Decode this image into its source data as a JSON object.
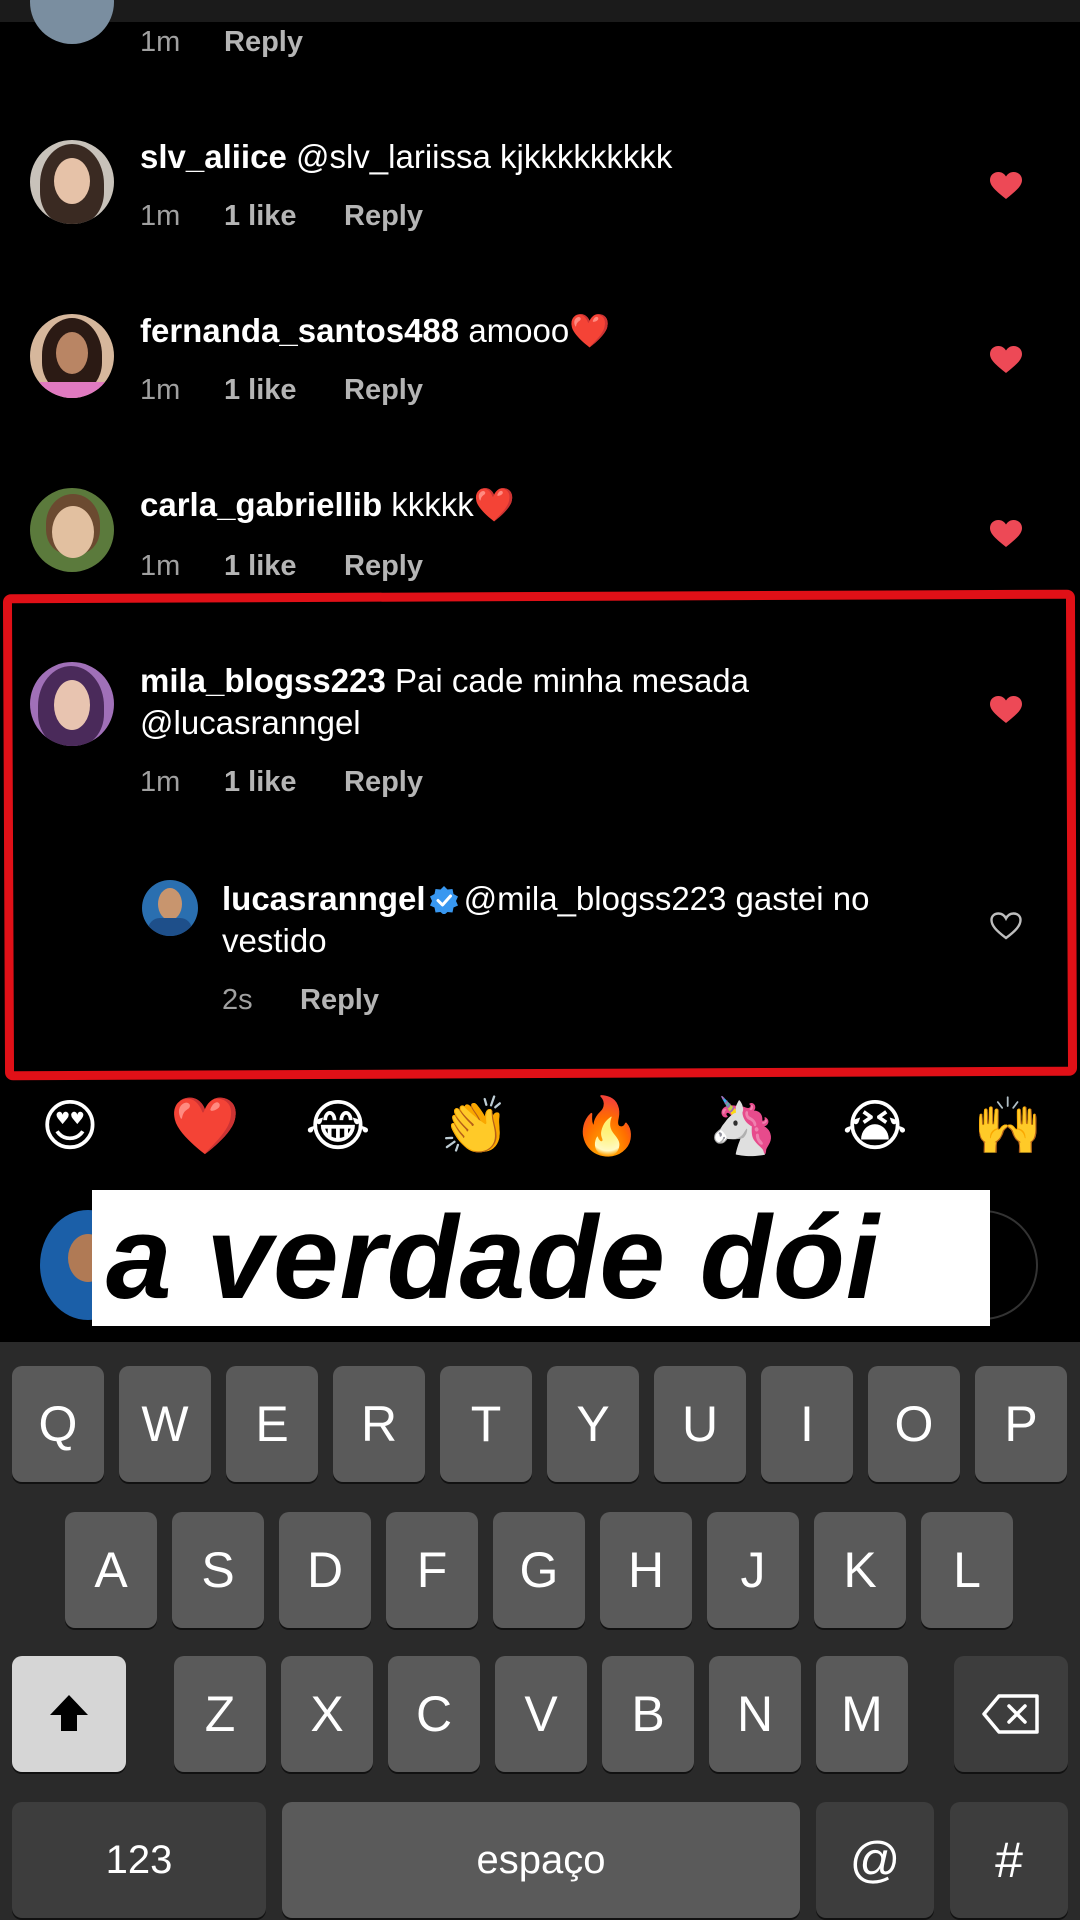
{
  "top_comment": {
    "time": "1m",
    "reply": "Reply"
  },
  "comments": [
    {
      "user": "slv_aliice",
      "text": "@slv_lariissa kjkkkkkkkkk",
      "time": "1m",
      "likes": "1 like",
      "reply": "Reply"
    },
    {
      "user": "fernanda_santos488",
      "text": "amooo❤️",
      "time": "1m",
      "likes": "1 like",
      "reply": "Reply"
    },
    {
      "user": "carla_gabriellib",
      "text": "kkkkk❤️",
      "time": "1m",
      "likes": "1 like",
      "reply": "Reply"
    },
    {
      "user": "mila_blogss223",
      "text": "Pai cade minha mesada @lucasranngel",
      "time": "1m",
      "likes": "1 like",
      "reply": "Reply"
    }
  ],
  "reply_comment": {
    "user": "lucasranngel",
    "text": "@mila_blogss223 gastei no vestido",
    "time": "2s",
    "reply": "Reply"
  },
  "emojis": [
    "😍",
    "❤️",
    "😂",
    "👏",
    "🔥",
    "🦄",
    "😭",
    "🙌"
  ],
  "sticker": "a verdade dói",
  "keyboard": {
    "row1": [
      "Q",
      "W",
      "E",
      "R",
      "T",
      "Y",
      "U",
      "I",
      "O",
      "P"
    ],
    "row2": [
      "A",
      "S",
      "D",
      "F",
      "G",
      "H",
      "J",
      "K",
      "L"
    ],
    "row3": [
      "Z",
      "X",
      "C",
      "V",
      "B",
      "N",
      "M"
    ],
    "numbers": "123",
    "space": "espaço",
    "at": "@",
    "hash": "#"
  },
  "colors": {
    "like_red": "#ed4956",
    "highlight_red": "#e01017",
    "verified_blue": "#3897f0"
  }
}
